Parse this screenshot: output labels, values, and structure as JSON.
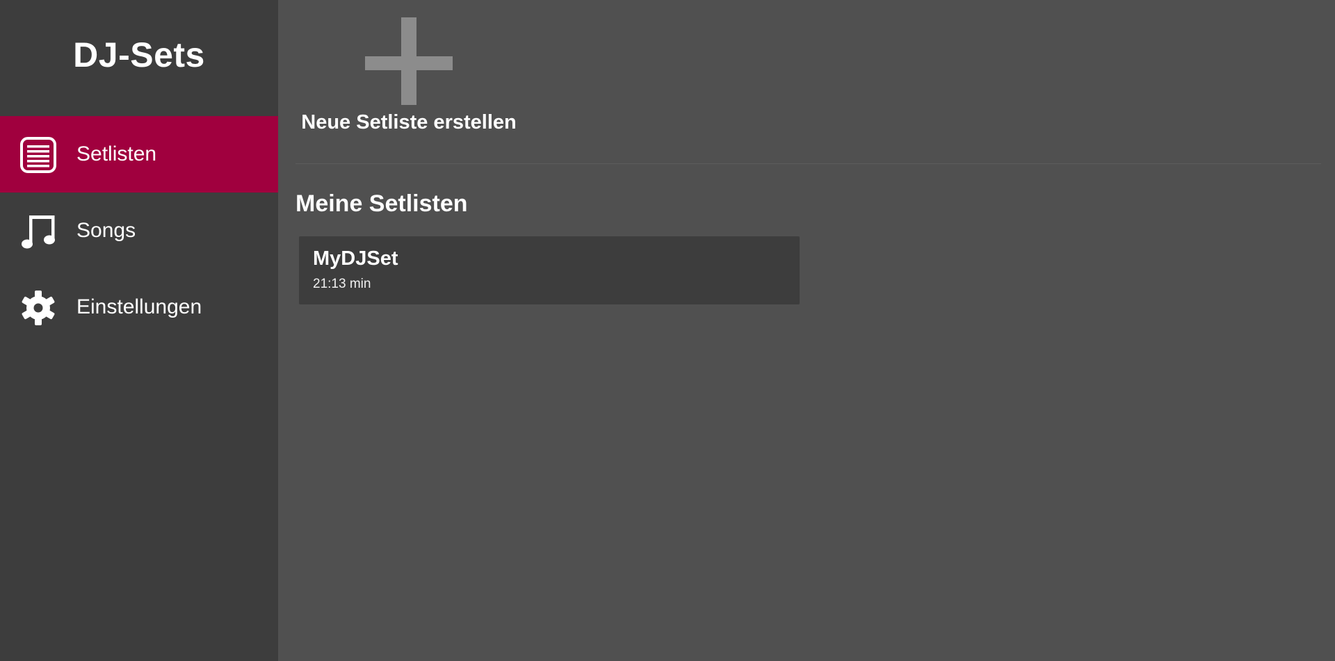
{
  "sidebar": {
    "title": "DJ-Sets",
    "accent_color": "#a0003e",
    "items": [
      {
        "label": "Setlisten",
        "icon": "list-icon",
        "active": true
      },
      {
        "label": "Songs",
        "icon": "music-note-icon",
        "active": false
      },
      {
        "label": "Einstellungen",
        "icon": "gear-icon",
        "active": false
      }
    ]
  },
  "main": {
    "new_setlist": {
      "label": "Neue Setliste erstellen",
      "icon": "plus-icon"
    },
    "section_title": "Meine Setlisten",
    "setlists": [
      {
        "name": "MyDJSet",
        "duration": "21:13 min"
      }
    ]
  }
}
